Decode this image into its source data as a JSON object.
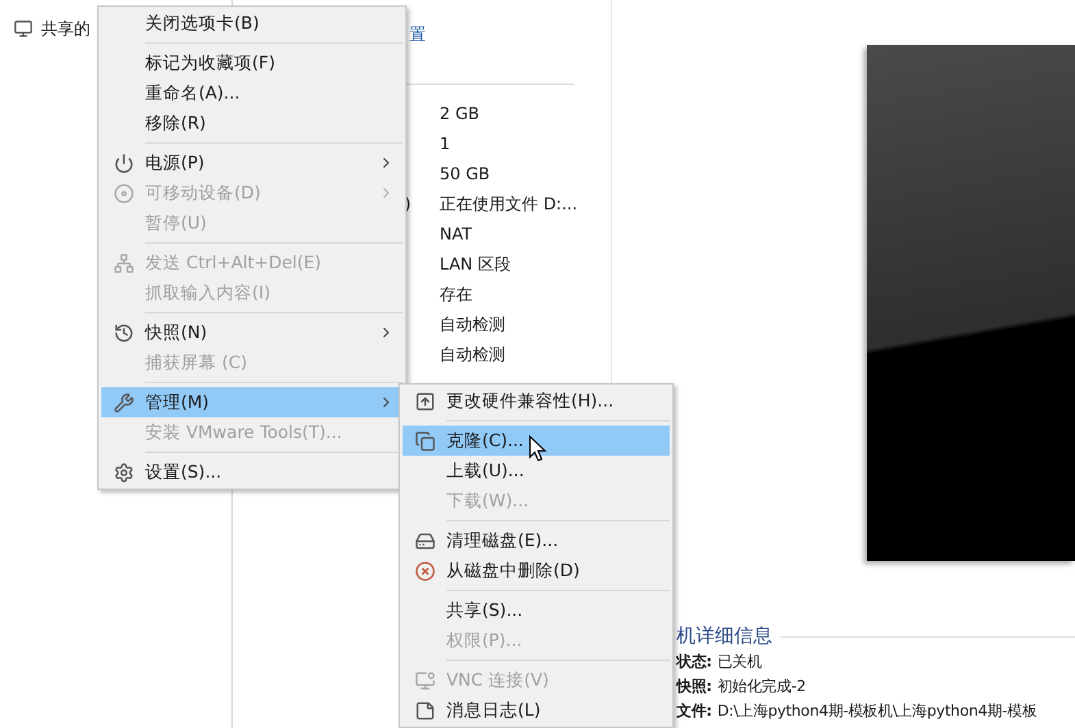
{
  "sidebar": {
    "items": [
      {
        "label": "共享的"
      }
    ]
  },
  "links": [
    {
      "label": "置"
    }
  ],
  "devices": [
    {
      "value": "2 GB"
    },
    {
      "value": "1"
    },
    {
      "value": "50 GB"
    },
    {
      "label": ")",
      "value": "正在使用文件 D:..."
    },
    {
      "value": "NAT"
    },
    {
      "value": "LAN 区段"
    },
    {
      "value": "存在"
    },
    {
      "value": "自动检测"
    },
    {
      "value": "自动检测"
    }
  ],
  "details": {
    "title": "机详细信息",
    "rows": [
      {
        "label": "状态:",
        "value": "已关机"
      },
      {
        "label": "快照:",
        "value": "初始化完成-2"
      },
      {
        "label": "文件:",
        "value": "D:\\上海python4期-模板机\\上海python4期-模板"
      }
    ]
  },
  "context_menu": {
    "items": [
      {
        "kind": "item",
        "label": "关闭选项卡(B)",
        "disabled": false,
        "selected": false,
        "submenu": false
      },
      {
        "kind": "separator"
      },
      {
        "kind": "item",
        "label": "标记为收藏项(F)",
        "disabled": false,
        "selected": false,
        "submenu": false
      },
      {
        "kind": "item",
        "label": "重命名(A)...",
        "disabled": false,
        "selected": false,
        "submenu": false
      },
      {
        "kind": "item",
        "label": "移除(R)",
        "disabled": false,
        "selected": false,
        "submenu": false
      },
      {
        "kind": "separator"
      },
      {
        "kind": "item",
        "label": "电源(P)",
        "disabled": false,
        "selected": false,
        "submenu": true
      },
      {
        "kind": "item",
        "label": "可移动设备(D)",
        "disabled": true,
        "selected": false,
        "submenu": true
      },
      {
        "kind": "item",
        "label": "暂停(U)",
        "disabled": true,
        "selected": false,
        "submenu": false
      },
      {
        "kind": "separator"
      },
      {
        "kind": "item",
        "label": "发送 Ctrl+Alt+Del(E)",
        "disabled": true,
        "selected": false,
        "submenu": false
      },
      {
        "kind": "item",
        "label": "抓取输入内容(I)",
        "disabled": true,
        "selected": false,
        "submenu": false
      },
      {
        "kind": "separator"
      },
      {
        "kind": "item",
        "label": "快照(N)",
        "disabled": false,
        "selected": false,
        "submenu": true
      },
      {
        "kind": "item",
        "label": "捕获屏幕 (C)",
        "disabled": true,
        "selected": false,
        "submenu": false
      },
      {
        "kind": "separator"
      },
      {
        "kind": "item",
        "label": "管理(M)",
        "disabled": false,
        "selected": true,
        "submenu": true
      },
      {
        "kind": "item",
        "label": "安装 VMware Tools(T)...",
        "disabled": true,
        "selected": false,
        "submenu": false
      },
      {
        "kind": "separator"
      },
      {
        "kind": "item",
        "label": "设置(S)...",
        "disabled": false,
        "selected": false,
        "submenu": false
      }
    ]
  },
  "submenu": {
    "items": [
      {
        "kind": "item",
        "label": "更改硬件兼容性(H)...",
        "disabled": false,
        "selected": false,
        "submenu": false
      },
      {
        "kind": "separator"
      },
      {
        "kind": "item",
        "label": "克隆(C)...",
        "disabled": false,
        "selected": true,
        "submenu": false
      },
      {
        "kind": "item",
        "label": "上载(U)...",
        "disabled": false,
        "selected": false,
        "submenu": false
      },
      {
        "kind": "item",
        "label": "下载(W)...",
        "disabled": true,
        "selected": false,
        "submenu": false
      },
      {
        "kind": "separator"
      },
      {
        "kind": "item",
        "label": "清理磁盘(E)...",
        "disabled": false,
        "selected": false,
        "submenu": false
      },
      {
        "kind": "item",
        "label": "从磁盘中删除(D)",
        "disabled": false,
        "selected": false,
        "submenu": false
      },
      {
        "kind": "separator"
      },
      {
        "kind": "item",
        "label": "共享(S)...",
        "disabled": false,
        "selected": false,
        "submenu": false
      },
      {
        "kind": "item",
        "label": "权限(P)...",
        "disabled": true,
        "selected": false,
        "submenu": false
      },
      {
        "kind": "separator"
      },
      {
        "kind": "item",
        "label": "VNC 连接(V)",
        "disabled": true,
        "selected": false,
        "submenu": false
      },
      {
        "kind": "item",
        "label": "消息日志(L)",
        "disabled": false,
        "selected": false,
        "submenu": false
      }
    ]
  }
}
